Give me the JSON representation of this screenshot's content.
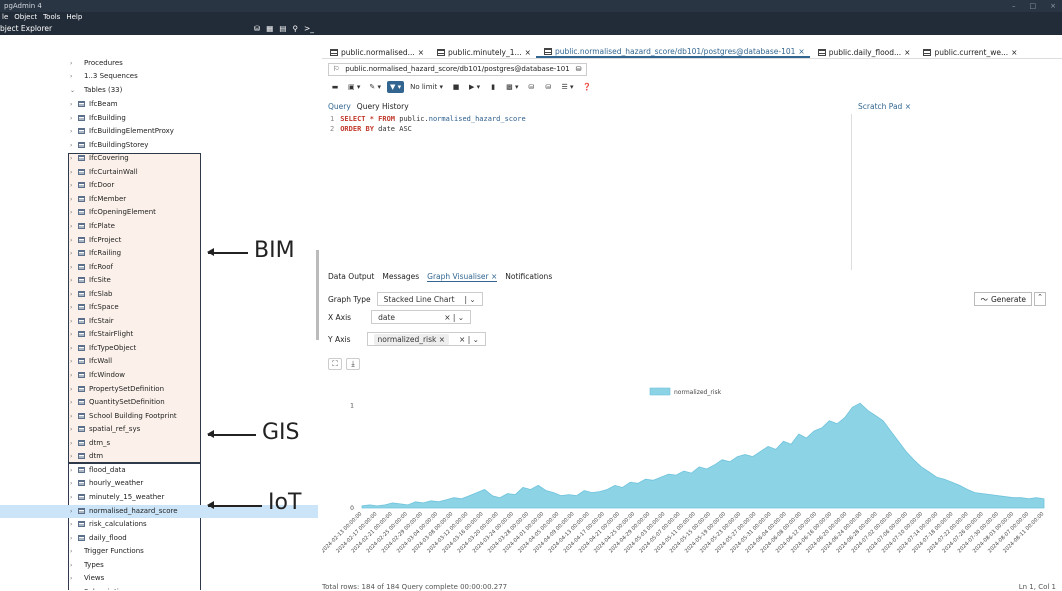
{
  "app": {
    "title": "pgAdmin 4",
    "window_controls": [
      "–",
      "□",
      "×"
    ]
  },
  "menu": [
    "le",
    "Object",
    "Tools",
    "Help"
  ],
  "object_explorer": {
    "title": "bject Explorer"
  },
  "tree": [
    {
      "label": "Procedures",
      "kind": "folder",
      "level": 0
    },
    {
      "label": "1..3 Sequences",
      "kind": "folder",
      "level": 0
    },
    {
      "label": "Tables (33)",
      "kind": "folder",
      "level": 0
    },
    {
      "label": "IfcBeam",
      "group": "bim"
    },
    {
      "label": "IfcBuilding",
      "group": "bim"
    },
    {
      "label": "IfcBuildingElementProxy",
      "group": "bim"
    },
    {
      "label": "IfcBuildingStorey",
      "group": "bim"
    },
    {
      "label": "IfcCovering",
      "group": "bim"
    },
    {
      "label": "IfcCurtainWall",
      "group": "bim"
    },
    {
      "label": "IfcDoor",
      "group": "bim"
    },
    {
      "label": "IfcMember",
      "group": "bim"
    },
    {
      "label": "IfcOpeningElement",
      "group": "bim"
    },
    {
      "label": "IfcPlate",
      "group": "bim"
    },
    {
      "label": "IfcProject",
      "group": "bim"
    },
    {
      "label": "IfcRailing",
      "group": "bim"
    },
    {
      "label": "IfcRoof",
      "group": "bim"
    },
    {
      "label": "IfcSite",
      "group": "bim"
    },
    {
      "label": "IfcSlab",
      "group": "bim"
    },
    {
      "label": "IfcSpace",
      "group": "bim"
    },
    {
      "label": "IfcStair",
      "group": "bim"
    },
    {
      "label": "IfcStairFlight",
      "group": "bim"
    },
    {
      "label": "IfcTypeObject",
      "group": "bim"
    },
    {
      "label": "IfcWall",
      "group": "bim"
    },
    {
      "label": "IfcWindow",
      "group": "bim"
    },
    {
      "label": "PropertySetDefinition",
      "group": "bim"
    },
    {
      "label": "QuantitySetDefinition",
      "group": "bim"
    },
    {
      "label": "School Building Footprint",
      "group": "gis"
    },
    {
      "label": "spatial_ref_sys",
      "group": "gis"
    },
    {
      "label": "dtm_s",
      "group": "gis"
    },
    {
      "label": "dtm",
      "group": "gis"
    },
    {
      "label": "flood_data",
      "group": "iot"
    },
    {
      "label": "hourly_weather",
      "group": "iot"
    },
    {
      "label": "minutely_15_weather",
      "group": "iot"
    },
    {
      "label": "normalised_hazard_score",
      "group": "iot",
      "selected": true
    },
    {
      "label": "risk_calculations",
      "group": "iot"
    },
    {
      "label": "daily_flood",
      "group": "iot"
    },
    {
      "label": "Trigger Functions",
      "kind": "folder"
    },
    {
      "label": "Types",
      "kind": "folder"
    },
    {
      "label": "Views",
      "kind": "folder"
    },
    {
      "label": "Subscriptions",
      "kind": "folder"
    }
  ],
  "annotations": {
    "bim": "BIM",
    "gis": "GIS",
    "iot": "IoT"
  },
  "tabs": [
    "public.normalised...",
    "public.minutely_1...",
    "public.normalised_hazard_score/db101/postgres@database-101",
    "public.daily_flood...",
    "public.current_we..."
  ],
  "active_tab": 2,
  "connection": "public.normalised_hazard_score/db101/postgres@database-101",
  "toolbar": {
    "limit": "No limit"
  },
  "query_tabs": [
    "Query",
    "Query History"
  ],
  "scratch": "Scratch Pad",
  "sql": [
    {
      "n": "1",
      "kw": "SELECT * FROM",
      "rest": " public.",
      "fn": "normalised_hazard_score"
    },
    {
      "n": "2",
      "kw": "ORDER BY",
      "rest": " date ASC",
      "fn": ""
    }
  ],
  "output_tabs": [
    "Data Output",
    "Messages",
    "Graph Visualiser",
    "Notifications"
  ],
  "graph": {
    "type_label": "Graph Type",
    "type": "Stacked Line Chart",
    "x_label": "X Axis",
    "x": "date",
    "y_label": "Y Axis",
    "y": "normalized_risk",
    "generate": "Generate"
  },
  "chart_data": {
    "type": "area",
    "series": [
      {
        "name": "normalized_risk",
        "values": [
          0.02,
          0.03,
          0.02,
          0.03,
          0.05,
          0.04,
          0.03,
          0.06,
          0.05,
          0.07,
          0.06,
          0.08,
          0.1,
          0.09,
          0.12,
          0.15,
          0.18,
          0.12,
          0.1,
          0.14,
          0.13,
          0.2,
          0.18,
          0.22,
          0.17,
          0.15,
          0.12,
          0.13,
          0.12,
          0.17,
          0.15,
          0.16,
          0.18,
          0.22,
          0.2,
          0.25,
          0.24,
          0.28,
          0.27,
          0.3,
          0.33,
          0.32,
          0.36,
          0.34,
          0.4,
          0.38,
          0.42,
          0.47,
          0.45,
          0.5,
          0.52,
          0.5,
          0.55,
          0.6,
          0.57,
          0.65,
          0.62,
          0.72,
          0.68,
          0.75,
          0.78,
          0.85,
          0.82,
          0.88,
          0.98,
          1.02,
          0.95,
          0.9,
          0.85,
          0.75,
          0.65,
          0.55,
          0.47,
          0.4,
          0.35,
          0.3,
          0.28,
          0.25,
          0.22,
          0.18,
          0.15,
          0.14,
          0.13,
          0.12,
          0.11,
          0.1,
          0.1,
          0.09,
          0.1,
          0.09
        ]
      }
    ],
    "ytick_labels": [
      "0",
      "1"
    ],
    "ylim": [
      0,
      1.1
    ],
    "xtick_labels": [
      "2024-02-13 00:00:00",
      "2024-02-17 00:00:00",
      "2024-02-21 00:00:00",
      "2024-02-25 00:00:00",
      "2024-02-29 00:00:00",
      "2024-03-04 00:00:00",
      "2024-03-08 00:00:00",
      "2024-03-12 00:00:00",
      "2024-03-16 00:00:00",
      "2024-03-20 00:00:00",
      "2024-03-24 00:00:00",
      "2024-03-28 00:00:00",
      "2024-04-01 00:00:00",
      "2024-04-05 00:00:00",
      "2024-04-09 00:00:00",
      "2024-04-13 00:00:00",
      "2024-04-17 00:00:00",
      "2024-04-21 00:00:00",
      "2024-04-25 00:00:00",
      "2024-04-29 00:00:00",
      "2024-05-03 00:00:00",
      "2024-05-07 00:00:00",
      "2024-05-11 00:00:00",
      "2024-05-15 00:00:00",
      "2024-05-19 00:00:00",
      "2024-05-23 00:00:00",
      "2024-05-27 00:00:00",
      "2024-05-31 00:00:00",
      "2024-06-04 00:00:00",
      "2024-06-08 00:00:00",
      "2024-06-12 00:00:00",
      "2024-06-16 00:00:00",
      "2024-06-20 00:00:00",
      "2024-06-24 00:00:00",
      "2024-06-28 00:00:00",
      "2024-07-02 00:00:00",
      "2024-07-06 00:00:00",
      "2024-07-10 00:00:00",
      "2024-07-14 00:00:00",
      "2024-07-18 00:00:00",
      "2024-07-22 00:00:00",
      "2024-07-26 00:00:00",
      "2024-07-30 00:00:00",
      "2024-08-03 00:00:00",
      "2024-08-07 00:00:00",
      "2024-08-11 00:00:00"
    ],
    "legend": "top-center",
    "color": "#8cd3e6"
  },
  "status": {
    "left": "Total rows: 184 of 184     Query complete 00:00:00.277",
    "right": "Ln 1, Col 1"
  }
}
